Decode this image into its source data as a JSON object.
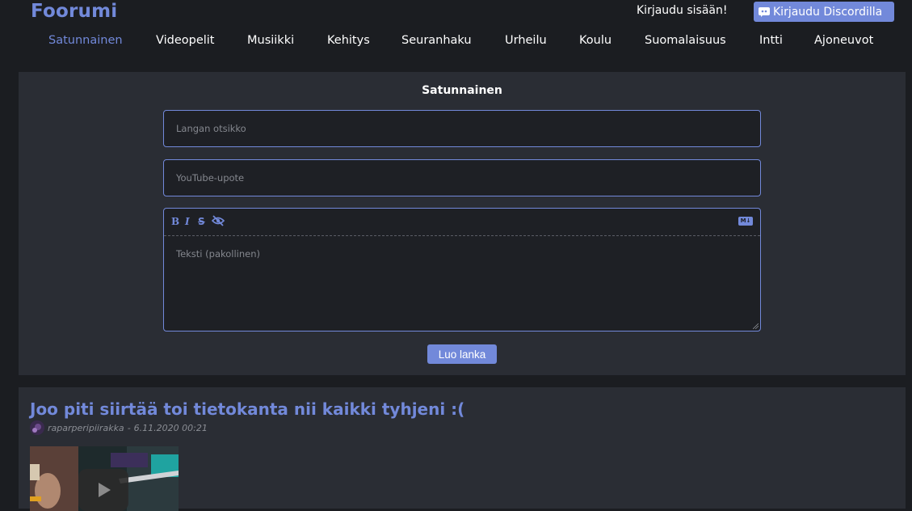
{
  "header": {
    "logo": "Foorumi",
    "login_label": "Kirjaudu sisään!",
    "discord_label": "Kirjaudu Discordilla"
  },
  "nav": {
    "items": [
      {
        "label": "Satunnainen",
        "active": true
      },
      {
        "label": "Videopelit"
      },
      {
        "label": "Musiikki"
      },
      {
        "label": "Kehitys"
      },
      {
        "label": "Seuranhaku"
      },
      {
        "label": "Urheilu"
      },
      {
        "label": "Koulu"
      },
      {
        "label": "Suomalaisuus"
      },
      {
        "label": "Intti"
      },
      {
        "label": "Ajoneuvot"
      }
    ]
  },
  "create": {
    "title": "Satunnainen",
    "thread_title_placeholder": "Langan otsikko",
    "youtube_placeholder": "YouTube-upote",
    "text_placeholder": "Teksti (pakollinen)",
    "toolbar": {
      "bold": "B",
      "italic": "I",
      "strike": "S",
      "spoiler_icon": "eye-slash-icon",
      "markdown": "M↓"
    },
    "submit_label": "Luo lanka"
  },
  "thread": {
    "title": "Joo piti siirtää toi tietokanta nii kaikki tyhjeni :(",
    "author": "raparperipiirakka",
    "separator": "-",
    "date": "6.11.2020 00:21"
  },
  "colors": {
    "accent": "#7289da",
    "background": "#1b1d21",
    "panel": "#2a2d34",
    "field": "#1e2025"
  }
}
